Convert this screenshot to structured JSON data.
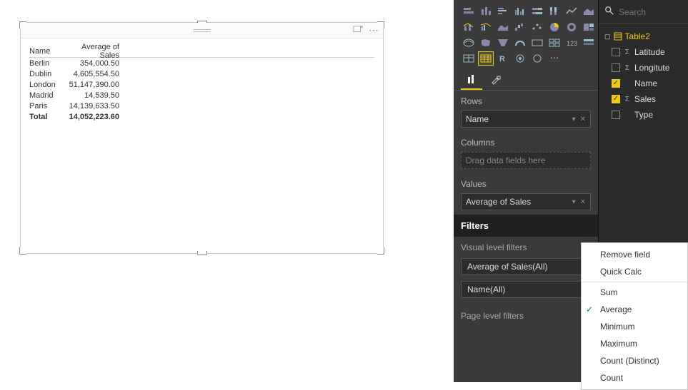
{
  "table": {
    "headers": {
      "name": "Name",
      "value": "Average of Sales"
    },
    "rows": [
      {
        "name": "Berlin",
        "value": "354,000.50"
      },
      {
        "name": "Dublin",
        "value": "4,605,554.50"
      },
      {
        "name": "London",
        "value": "51,147,390.00"
      },
      {
        "name": "Madrid",
        "value": "14,539.50"
      },
      {
        "name": "Paris",
        "value": "14,139,633.50"
      }
    ],
    "total": {
      "name": "Total",
      "value": "14,052,223.60"
    }
  },
  "viz": {
    "tabs": {
      "fields": "fields",
      "format": "format"
    },
    "rows": {
      "label": "Rows",
      "chip": "Name"
    },
    "columns": {
      "label": "Columns",
      "placeholder": "Drag data fields here"
    },
    "values": {
      "label": "Values",
      "chip": "Average of Sales"
    },
    "filters": {
      "header": "Filters",
      "visual_label": "Visual level filters",
      "chip1": "Average of Sales(All)",
      "chip2": "Name(All)",
      "page_label": "Page level filters"
    }
  },
  "fields": {
    "search_placeholder": "Search",
    "table_name": "Table2",
    "cols": {
      "latitude": "Latitude",
      "longitute": "Longitute",
      "name": "Name",
      "sales": "Sales",
      "type": "Type"
    }
  },
  "ctx": {
    "remove": "Remove field",
    "quick": "Quick Calc",
    "sum": "Sum",
    "avg": "Average",
    "min": "Minimum",
    "max": "Maximum",
    "cntd": "Count (Distinct)",
    "cnt": "Count"
  },
  "chart_data": {
    "type": "table",
    "columns": [
      "Name",
      "Average of Sales"
    ],
    "rows": [
      [
        "Berlin",
        354000.5
      ],
      [
        "Dublin",
        4605554.5
      ],
      [
        "London",
        51147390.0
      ],
      [
        "Madrid",
        14539.5
      ],
      [
        "Paris",
        14139633.5
      ]
    ],
    "total": [
      "Total",
      14052223.6
    ]
  }
}
